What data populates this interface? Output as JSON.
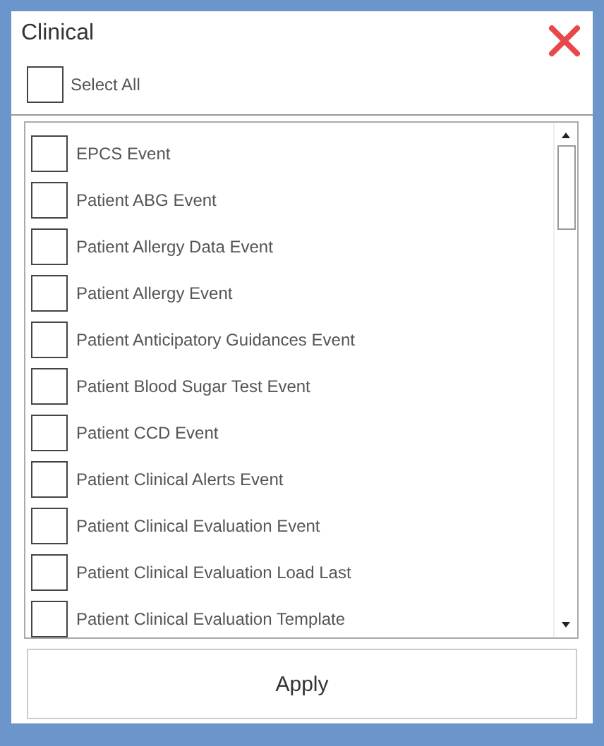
{
  "title": "Clinical",
  "select_all": {
    "label": "Select All",
    "checked": false
  },
  "items": [
    {
      "label": "EPCS Event",
      "checked": false
    },
    {
      "label": "Patient ABG Event",
      "checked": false
    },
    {
      "label": "Patient Allergy Data Event",
      "checked": false
    },
    {
      "label": "Patient Allergy Event",
      "checked": false
    },
    {
      "label": "Patient Anticipatory Guidances Event",
      "checked": false
    },
    {
      "label": "Patient Blood Sugar Test Event",
      "checked": false
    },
    {
      "label": "Patient CCD Event",
      "checked": false
    },
    {
      "label": "Patient Clinical Alerts Event",
      "checked": false
    },
    {
      "label": "Patient Clinical Evaluation Event",
      "checked": false
    },
    {
      "label": "Patient Clinical Evaluation Load Last",
      "checked": false
    },
    {
      "label": "Patient Clinical Evaluation Template",
      "checked": false
    }
  ],
  "apply_button": "Apply"
}
